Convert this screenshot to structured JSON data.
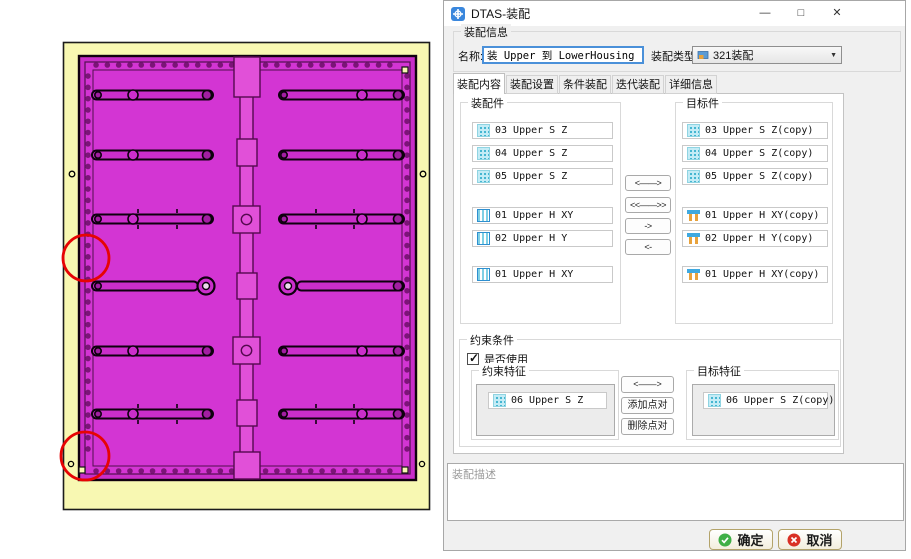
{
  "window": {
    "title": "DTAS-装配",
    "minimize": "—",
    "maximize": "□",
    "close": "✕"
  },
  "info": {
    "group_label": "装配信息",
    "name_label": "名称:",
    "name_value": "装 Upper 到 LowerHousing",
    "type_label": "装配类型:",
    "type_value": "321装配"
  },
  "tabs": {
    "items": [
      "装配内容",
      "装配设置",
      "条件装配",
      "迭代装配",
      "详细信息"
    ],
    "active": "装配内容"
  },
  "content": {
    "source": {
      "label": "装配件",
      "items": [
        {
          "icon": "surface",
          "text": "03 Upper S Z"
        },
        {
          "icon": "surface",
          "text": "04 Upper S Z"
        },
        {
          "icon": "surface",
          "text": "05 Upper S Z"
        },
        {
          "icon": "hole",
          "text": "01 Upper H XY"
        },
        {
          "icon": "hole",
          "text": "02 Upper H Y"
        },
        {
          "icon": "hole",
          "text": "01 Upper H XY"
        }
      ]
    },
    "target": {
      "label": "目标件",
      "items": [
        {
          "icon": "surface",
          "text": "03 Upper S Z(copy)"
        },
        {
          "icon": "surface",
          "text": "04 Upper S Z(copy)"
        },
        {
          "icon": "surface",
          "text": "05 Upper S Z(copy)"
        },
        {
          "icon": "pin",
          "text": "01 Upper H XY(copy)"
        },
        {
          "icon": "pin",
          "text": "02 Upper H Y(copy)"
        },
        {
          "icon": "pin",
          "text": "01 Upper H XY(copy)"
        }
      ]
    },
    "transfer": [
      "<——>",
      "<<——>>",
      "->",
      "<-"
    ]
  },
  "constraint": {
    "group_label": "约束条件",
    "use_label": "是否使用",
    "use_checked": true,
    "source": {
      "label": "约束特征",
      "item": {
        "icon": "surface",
        "text": "06 Upper S Z"
      }
    },
    "target": {
      "label": "目标特征",
      "item": {
        "icon": "surface",
        "text": "06 Upper S Z(copy)"
      }
    },
    "buttons": [
      "<——>",
      "添加点对",
      "删除点对"
    ]
  },
  "description": {
    "placeholder": "装配描述"
  },
  "footer": {
    "ok": "确定",
    "cancel": "取消"
  },
  "colors": {
    "board_magenta": "#cb2ecb",
    "fixture_yellow": "#f8f8b2",
    "annotation_red": "#e60404",
    "focus_blue": "#4a90d9"
  }
}
